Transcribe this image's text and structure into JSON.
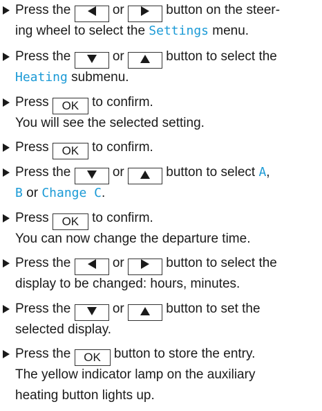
{
  "colors": {
    "term": "#1b9ad6",
    "text": "#1a1a1a"
  },
  "steps": [
    {
      "l1": {
        "a": "Press the",
        "b": "or",
        "c": "button on the steer-"
      },
      "l2": {
        "a": "ing wheel to select the",
        "term": "Settings",
        "b": "menu."
      }
    },
    {
      "l1": {
        "a": "Press the",
        "b": "or",
        "c": "button to select the"
      },
      "l2": {
        "term": "Heating",
        "b": "submenu."
      }
    },
    {
      "l1": {
        "a": "Press",
        "key": "OK",
        "c": "to confirm."
      },
      "l2": {
        "a": "You will see the selected setting."
      }
    },
    {
      "l1": {
        "a": "Press",
        "key": "OK",
        "c": "to confirm."
      }
    },
    {
      "l1": {
        "a": "Press the",
        "b": "or",
        "c": "button to select",
        "t1": "A",
        "sep": ","
      },
      "l2": {
        "t2": "B",
        "b": "or",
        "t3": "Change C",
        "end": "."
      }
    },
    {
      "l1": {
        "a": "Press",
        "key": "OK",
        "c": "to confirm."
      },
      "l2": {
        "a": "You can now change the departure time."
      }
    },
    {
      "l1": {
        "a": "Press the",
        "b": "or",
        "c": "button to select the"
      },
      "l2": {
        "a": "display to be changed: hours, minutes."
      }
    },
    {
      "l1": {
        "a": "Press the",
        "b": "or",
        "c": "button to set the"
      },
      "l2": {
        "a": "selected display."
      }
    },
    {
      "l1": {
        "a": "Press the",
        "key": "OK",
        "c": "button to store the entry."
      },
      "l2": {
        "a": "The yellow indicator lamp on the auxiliary"
      },
      "l3": {
        "a": "heating button lights up."
      }
    }
  ]
}
